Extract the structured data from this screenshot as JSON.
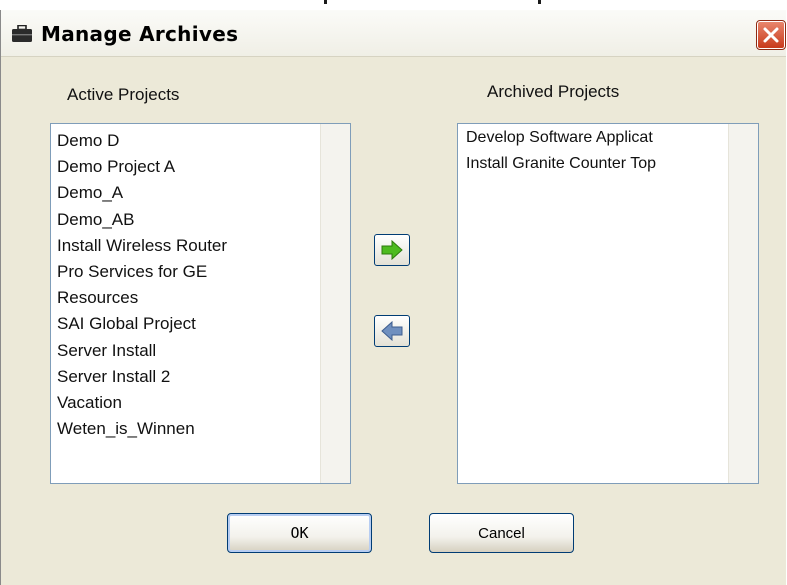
{
  "window": {
    "title": "Manage Archives",
    "title_icon": "briefcase-icon",
    "close_icon": "close-icon"
  },
  "active": {
    "label": "Active Projects",
    "items": [
      "Demo D",
      "Demo Project A",
      "Demo_A",
      "Demo_AB",
      "Install Wireless Router",
      "Pro Services for GE",
      "Resources",
      "SAI Global Project",
      "Server Install",
      "Server Install 2",
      "Vacation",
      "Weten_is_Winnen"
    ]
  },
  "archived": {
    "label": "Archived Projects",
    "items": [
      "Develop Software Applicat",
      "Install Granite Counter Top"
    ]
  },
  "transfer": {
    "archive_icon": "arrow-right-icon",
    "restore_icon": "arrow-left-icon",
    "archive_color": "#4dbb1f",
    "restore_color": "#6f8fbf"
  },
  "buttons": {
    "ok_label": "OK",
    "cancel_label": "Cancel"
  }
}
